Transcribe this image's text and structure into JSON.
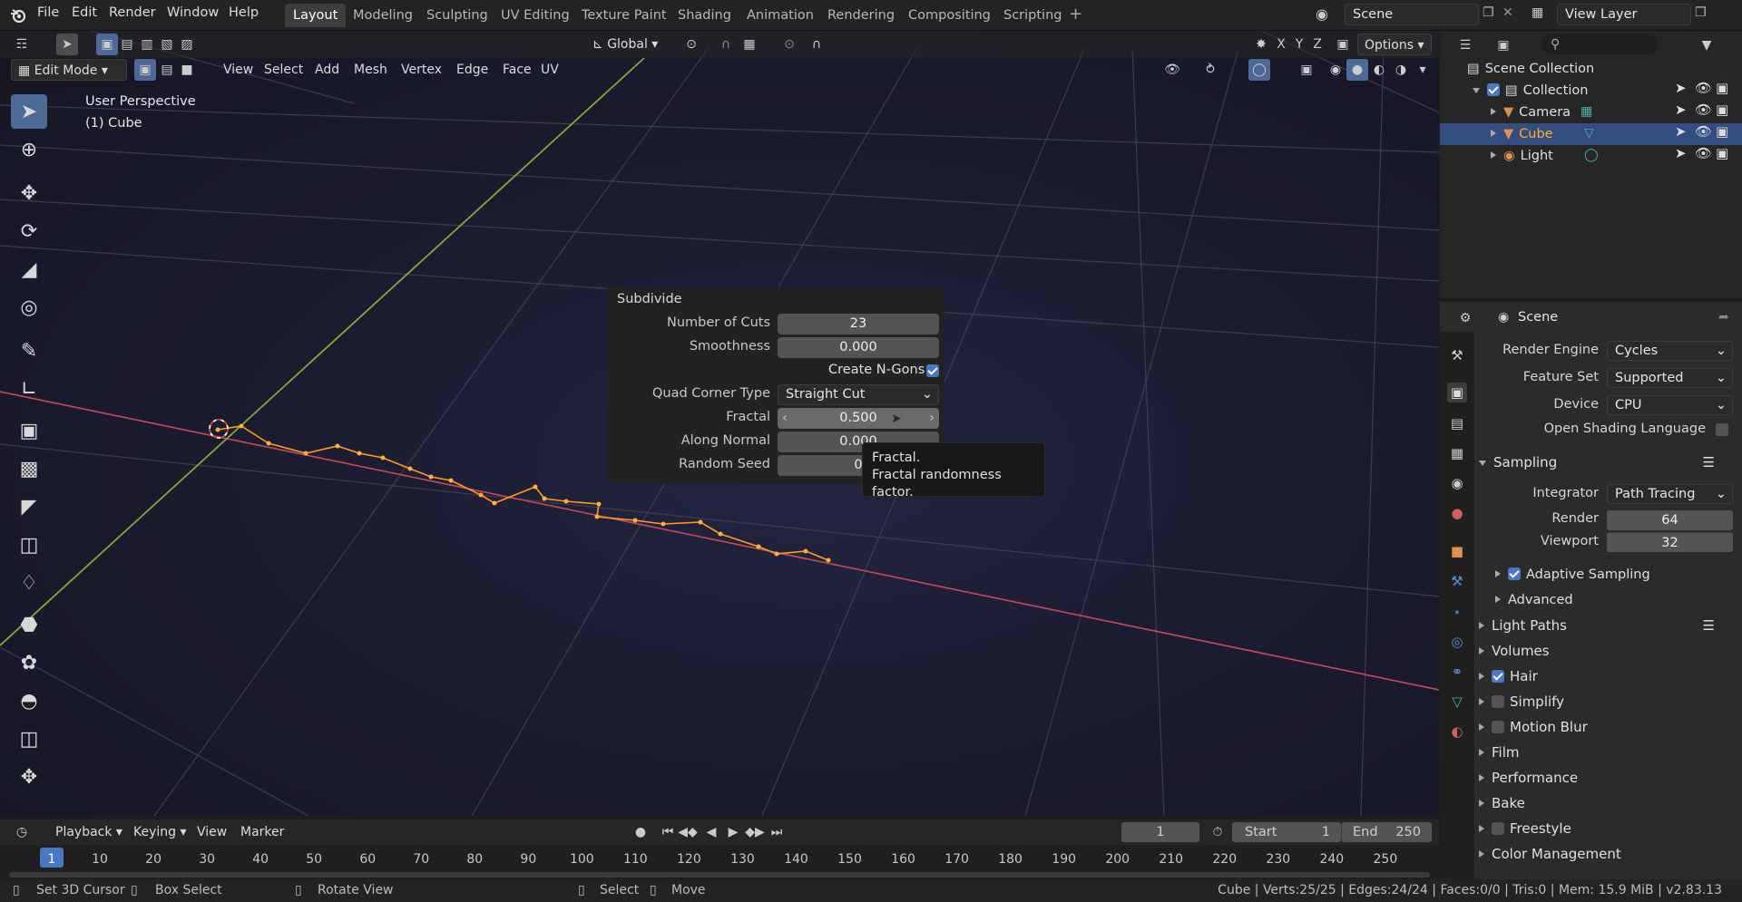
{
  "topbar": {
    "menus": [
      "File",
      "Edit",
      "Render",
      "Window",
      "Help"
    ],
    "workspaces": [
      "Layout",
      "Modeling",
      "Sculpting",
      "UV Editing",
      "Texture Paint",
      "Shading",
      "Animation",
      "Rendering",
      "Compositing",
      "Scripting"
    ],
    "active_workspace": "Layout",
    "scene": "Scene",
    "view_layer": "View Layer"
  },
  "tool_header": {
    "orientation": "Global",
    "axes": [
      "X",
      "Y",
      "Z"
    ],
    "options": "Options"
  },
  "edit_header": {
    "mode": "Edit Mode",
    "menus": [
      "View",
      "Select",
      "Add",
      "Mesh",
      "Vertex",
      "Edge",
      "Face",
      "UV"
    ]
  },
  "viewport": {
    "perspective": "User Perspective",
    "object": "(1) Cube"
  },
  "operator_panel": {
    "title": "Subdivide",
    "number_of_cuts_label": "Number of Cuts",
    "number_of_cuts": "23",
    "smoothness_label": "Smoothness",
    "smoothness": "0.000",
    "create_ngons_label": "Create N-Gons",
    "create_ngons": true,
    "quad_corner_label": "Quad Corner Type",
    "quad_corner": "Straight Cut",
    "fractal_label": "Fractal",
    "fractal": "0.500",
    "along_normal_label": "Along Normal",
    "along_normal": "0.000",
    "random_seed_label": "Random Seed",
    "random_seed": "0"
  },
  "tooltip": {
    "title": "Fractal.",
    "description": "Fractal randomness factor."
  },
  "timeline": {
    "menus": [
      "Playback",
      "Keying",
      "View",
      "Marker"
    ],
    "current_frame": "1",
    "start_label": "Start",
    "start": "1",
    "end_label": "End",
    "end": "250",
    "ticks": [
      "1",
      "10",
      "20",
      "30",
      "40",
      "50",
      "60",
      "70",
      "80",
      "90",
      "100",
      "110",
      "120",
      "130",
      "140",
      "150",
      "160",
      "170",
      "180",
      "190",
      "200",
      "210",
      "220",
      "230",
      "240",
      "250"
    ]
  },
  "statusbar": {
    "hints": [
      "Set 3D Cursor",
      "Box Select",
      "Rotate View",
      "Select",
      "Move"
    ],
    "stats": "Cube | Verts:25/25 | Edges:24/24 | Faces:0/0 | Tris:0 | Mem: 15.9 MiB | v2.83.13"
  },
  "outliner": {
    "root": "Scene Collection",
    "collection": "Collection",
    "items": [
      "Camera",
      "Cube",
      "Light"
    ],
    "selected": "Cube"
  },
  "properties": {
    "context": "Scene",
    "render_engine_label": "Render Engine",
    "render_engine": "Cycles",
    "feature_set_label": "Feature Set",
    "feature_set": "Supported",
    "device_label": "Device",
    "device": "CPU",
    "osl_label": "Open Shading Language",
    "sampling": {
      "title": "Sampling",
      "integrator_label": "Integrator",
      "integrator": "Path Tracing",
      "render_label": "Render",
      "render": "64",
      "viewport_label": "Viewport",
      "viewport": "32",
      "adaptive_label": "Adaptive Sampling",
      "advanced_label": "Advanced"
    },
    "sections": [
      "Light Paths",
      "Volumes",
      "Hair",
      "Simplify",
      "Motion Blur",
      "Film",
      "Performance",
      "Bake",
      "Freestyle",
      "Color Management"
    ]
  },
  "colors": {
    "accent": "#4a78c4",
    "selection": "#ffaf29",
    "x_axis": "#c9485b",
    "y_axis": "#84a83a"
  }
}
